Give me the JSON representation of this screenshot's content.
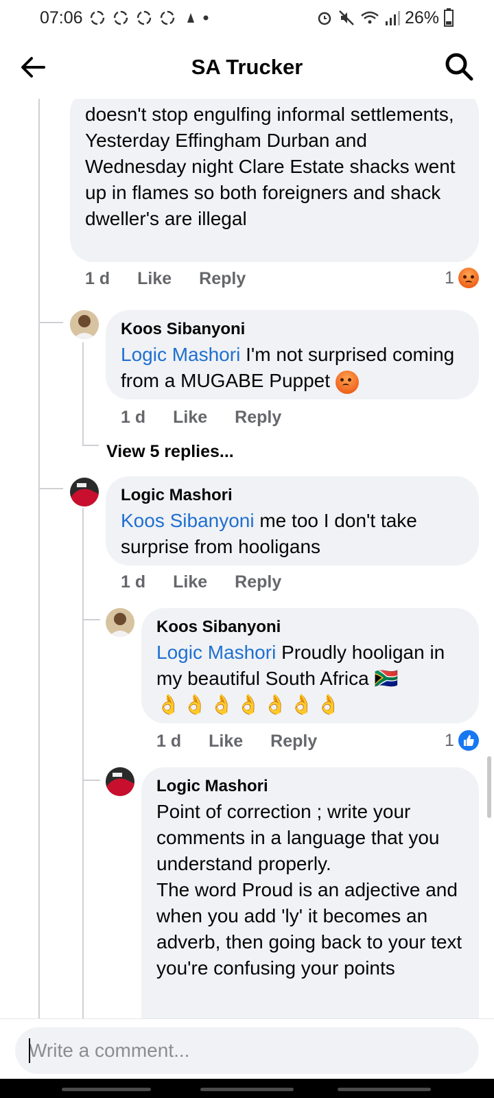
{
  "status_bar": {
    "time": "07:06",
    "battery": "26%"
  },
  "app_bar": {
    "title": "SA Trucker"
  },
  "comments": [
    {
      "lines_before_mention": "",
      "text": "doesn't stop engulfing informal settlements,\nYesterday Effingham Durban and Wednesday night Clare Estate shacks went up in flames so both foreigners and shack dweller's are illegal",
      "time": "1 d",
      "like": "Like",
      "reply": "Reply",
      "reaction_count": "1",
      "reaction_icon": "angry-emoji-icon"
    },
    {
      "author": "Koos Sibanyoni",
      "mention": "Logic Mashori",
      "text": " I'm not surprised coming from a MUGABE Puppet",
      "time": "1 d",
      "like": "Like",
      "reply": "Reply"
    },
    {
      "view_replies": "View 5 replies..."
    },
    {
      "author": "Logic Mashori",
      "mention": "Koos Sibanyoni",
      "text": " me too I don't take surprise from hooligans",
      "time": "1 d",
      "like": "Like",
      "reply": "Reply"
    },
    {
      "author": "Koos Sibanyoni",
      "mention": "Logic Mashori",
      "text": " Proudly hooligan in my beautiful South Africa 🇿🇦",
      "emoji_row": "👌👌👌👌👌👌👌",
      "time": "1 d",
      "like": "Like",
      "reply": "Reply",
      "reaction_count": "1",
      "reaction_icon": "like-icon"
    },
    {
      "author": "Logic Mashori",
      "text": "Point of correction ; write your comments in a language that you understand properly.\nThe word Proud is an adjective and when you add 'ly' it becomes an adverb, then going back to your text you're confusing your points"
    }
  ],
  "composer": {
    "placeholder": "Write a comment..."
  },
  "colors": {
    "mention": "#1f6fd1",
    "bubble": "#f0f2f5",
    "meta": "#65676b",
    "like_blue": "#1877f2",
    "angry_orange": "#f0651e"
  }
}
